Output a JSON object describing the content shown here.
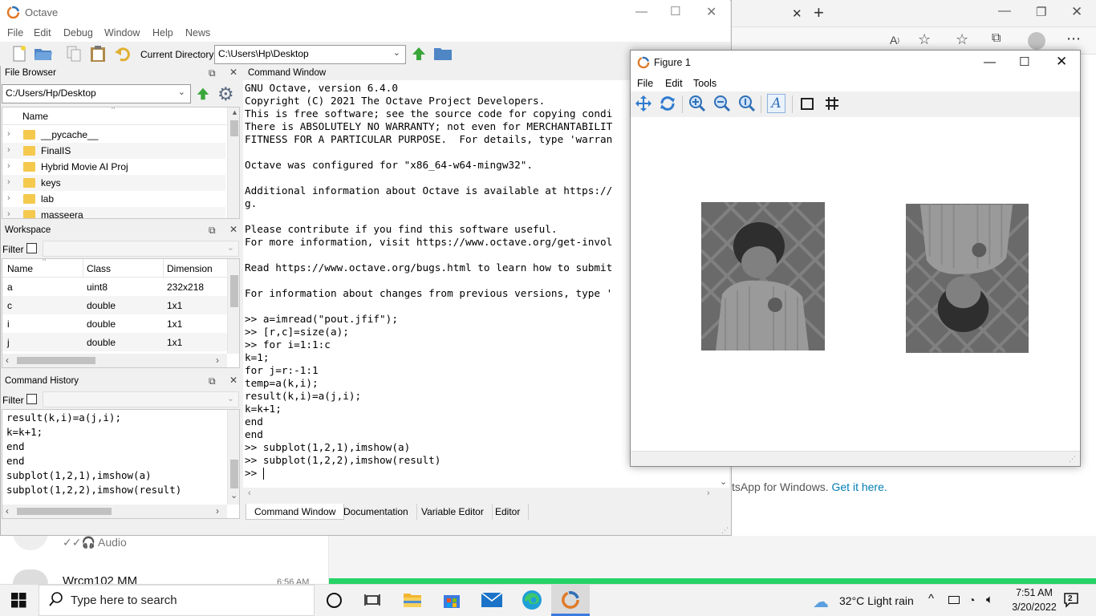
{
  "octave": {
    "title": "Octave",
    "menu": [
      "File",
      "Edit",
      "Debug",
      "Window",
      "Help",
      "News"
    ],
    "current_directory_label": "Current Directory:",
    "current_directory_value": "C:\\Users\\Hp\\Desktop",
    "file_browser": {
      "title": "File Browser",
      "path": "C:/Users/Hp/Desktop",
      "column": "Name",
      "items": [
        "__pycache__",
        "FinalIS",
        "Hybrid Movie AI Proj",
        "keys",
        "lab",
        "masseera"
      ]
    },
    "workspace": {
      "title": "Workspace",
      "filter_label": "Filter",
      "columns": [
        "Name",
        "Class",
        "Dimension"
      ],
      "rows": [
        {
          "name": "a",
          "class": "uint8",
          "dimension": "232x218"
        },
        {
          "name": "c",
          "class": "double",
          "dimension": "1x1"
        },
        {
          "name": "i",
          "class": "double",
          "dimension": "1x1"
        },
        {
          "name": "j",
          "class": "double",
          "dimension": "1x1"
        }
      ]
    },
    "command_history": {
      "title": "Command History",
      "filter_label": "Filter",
      "lines": [
        "result(k,i)=a(j,i);",
        "k=k+1;",
        "end",
        "end",
        "subplot(1,2,1),imshow(a)",
        "subplot(1,2,2),imshow(result)"
      ]
    },
    "command_window": {
      "title": "Command Window",
      "lines": [
        "GNU Octave, version 6.4.0",
        "Copyright (C) 2021 The Octave Project Developers.",
        "This is free software; see the source code for copying condi",
        "There is ABSOLUTELY NO WARRANTY; not even for MERCHANTABILIT",
        "FITNESS FOR A PARTICULAR PURPOSE.  For details, type 'warran",
        "",
        "Octave was configured for \"x86_64-w64-mingw32\".",
        "",
        "Additional information about Octave is available at https://",
        "g.",
        "",
        "Please contribute if you find this software useful.",
        "For more information, visit https://www.octave.org/get-invol",
        "",
        "Read https://www.octave.org/bugs.html to learn how to submit",
        "",
        "For information about changes from previous versions, type '",
        "",
        ">> a=imread(\"pout.jfif\");",
        ">> [r,c]=size(a);",
        ">> for i=1:1:c",
        "k=1;",
        "for j=r:-1:1",
        "temp=a(k,i);",
        "result(k,i)=a(j,i);",
        "k=k+1;",
        "end",
        "end",
        ">> subplot(1,2,1),imshow(a)",
        ">> subplot(1,2,2),imshow(result)",
        ">> "
      ]
    },
    "tabs": [
      "Command Window",
      "Documentation",
      "Variable Editor",
      "Editor"
    ]
  },
  "figure": {
    "title": "Figure 1",
    "menu": [
      "File",
      "Edit",
      "Tools"
    ]
  },
  "background": {
    "whatsapp_text": "tsApp for Windows.",
    "whatsapp_link": "Get it here.",
    "chat_preview": "Audio",
    "chat_name": "Wrcm102 MM",
    "chat_time": "6:56 AM"
  },
  "taskbar": {
    "search_placeholder": "Type here to search",
    "weather": "32°C  Light rain",
    "time": "7:51 AM",
    "date": "3/20/2022",
    "notification_count": "2"
  },
  "colors": {
    "octave_accent": "#e07b2a",
    "taskbar_bg": "#f2f2f2",
    "whatsapp_green": "#25d366",
    "link_blue": "#027eb5"
  }
}
